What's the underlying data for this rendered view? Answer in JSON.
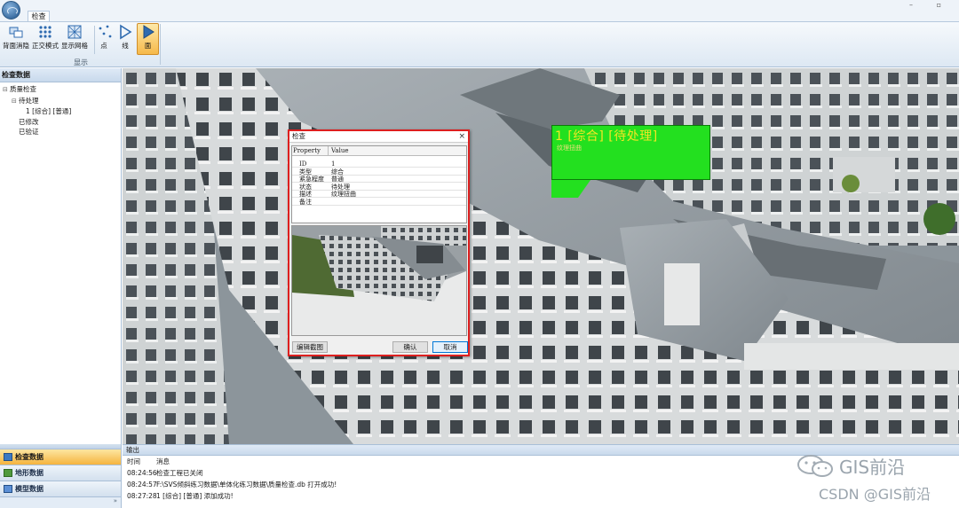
{
  "window": {
    "tab": "检查",
    "controls": "– ▫"
  },
  "ribbon": {
    "buttons": [
      {
        "label": "背面消隐",
        "icon": "backface-cull-icon"
      },
      {
        "label": "正交模式",
        "icon": "ortho-grid-icon"
      },
      {
        "label": "显示网格",
        "icon": "mesh-grid-icon"
      },
      {
        "label": "点",
        "icon": "point-icon"
      },
      {
        "label": "线",
        "icon": "line-icon"
      },
      {
        "label": "面",
        "icon": "face-icon",
        "active": true
      }
    ],
    "group_label": "显示"
  },
  "left_panel": {
    "title": "检查数据",
    "tree": [
      {
        "label": "质量检查",
        "level": 0,
        "expander": "⊟"
      },
      {
        "label": "待处理",
        "level": 1,
        "expander": "⊟"
      },
      {
        "label": "1 [综合] [普通]",
        "level": 2,
        "expander": ""
      },
      {
        "label": "已修改",
        "level": 1,
        "expander": ""
      },
      {
        "label": "已验证",
        "level": 1,
        "expander": ""
      }
    ]
  },
  "nav": {
    "items": [
      {
        "label": "检查数据",
        "active": true
      },
      {
        "label": "地形数据",
        "active": false
      },
      {
        "label": "模型数据",
        "active": false
      }
    ],
    "more": "»"
  },
  "callout": {
    "title": "1 [综合] [待处理]",
    "subtitle": "纹理扭曲"
  },
  "dialog": {
    "title": "检查",
    "close": "×",
    "grid_header": {
      "property": "Property",
      "value": "Value"
    },
    "properties": [
      {
        "key": "ID",
        "value": "1"
      },
      {
        "key": "类型",
        "value": "综合"
      },
      {
        "key": "紧急程度",
        "value": "普通"
      },
      {
        "key": "状态",
        "value": "待处理"
      },
      {
        "key": "描述",
        "value": "纹理扭曲"
      },
      {
        "key": "备注",
        "value": ""
      }
    ],
    "buttons": {
      "edit": "编辑截图",
      "ok": "确认",
      "cancel": "取消"
    }
  },
  "output": {
    "title": "输出",
    "columns": {
      "time": "时间",
      "message": "消息"
    },
    "rows": [
      {
        "time": "08:24:56",
        "message": "检查工程已关闭"
      },
      {
        "time": "08:24:57",
        "message": "F:\\SVS倾斜练习数据\\单体化练习数据\\质量检查.db 打开成功!"
      },
      {
        "time": "08:27:28",
        "message": "1 [综合] [普通] 添加成功!"
      }
    ]
  },
  "watermark": {
    "brand": "GIS前沿",
    "csdn": "CSDN @GIS前沿"
  },
  "colors": {
    "callout_fill": "#23e01f",
    "callout_text": "#f3e624",
    "dialog_border": "#dd1f1f",
    "active_nav": "#f5b33e"
  }
}
